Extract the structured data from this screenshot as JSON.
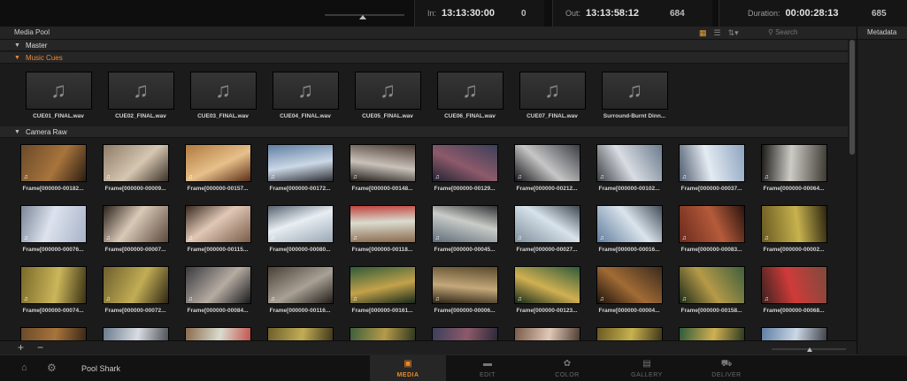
{
  "topbar": {
    "in_label": "In:",
    "in_value": "13:13:30:00",
    "in_count": "0",
    "out_label": "Out:",
    "out_value": "13:13:58:12",
    "out_count": "684",
    "duration_label": "Duration:",
    "duration_value": "00:00:28:13",
    "duration_count": "685"
  },
  "media_pool": {
    "title": "Media Pool",
    "metadata_title": "Metadata",
    "search_placeholder": "Search"
  },
  "bins": {
    "master": "Master",
    "music_cues": "Music Cues",
    "camera_raw": "Camera Raw"
  },
  "audio_clips": [
    "CUE01_FINAL.wav",
    "CUE02_FINAL.wav",
    "CUE03_FINAL.wav",
    "CUE04_FINAL.wav",
    "CUE05_FINAL.wav",
    "CUE06_FINAL.wav",
    "CUE07_FINAL.wav",
    "Surround-Burnt Dinn..."
  ],
  "video_clips": [
    "Frame[000000-00182...",
    "Frame[000000-00009...",
    "Frame[000000-00157...",
    "Frame[000000-00172...",
    "Frame[000000-00148...",
    "Frame[000000-00129...",
    "Frame[000000-00212...",
    "Frame[000000-00102...",
    "Frame[000000-00037...",
    "Frame[000000-00064...",
    "Frame[000000-00076...",
    "Frame[000000-00007...",
    "Frame[000000-00115...",
    "Frame[000000-00080...",
    "Frame[000000-00118...",
    "Frame[000000-00045...",
    "Frame[000000-00027...",
    "Frame[000000-00016...",
    "Frame[000000-00083...",
    "Frame[000000-00002...",
    "Frame[000000-00074...",
    "Frame[000000-00072...",
    "Frame[000000-00084...",
    "Frame[000000-00116...",
    "Frame[000000-00161...",
    "Frame[000000-00006...",
    "Frame[000000-00123...",
    "Frame[000000-00004...",
    "Frame[000000-00158...",
    "Frame[000000-00068..."
  ],
  "bottom": {
    "add": "+",
    "remove": "−"
  },
  "footer": {
    "project_name": "Pool Shark",
    "tabs": [
      "MEDIA",
      "EDIT",
      "COLOR",
      "GALLERY",
      "DELIVER"
    ]
  },
  "colors": {
    "accent": "#e8892a"
  }
}
